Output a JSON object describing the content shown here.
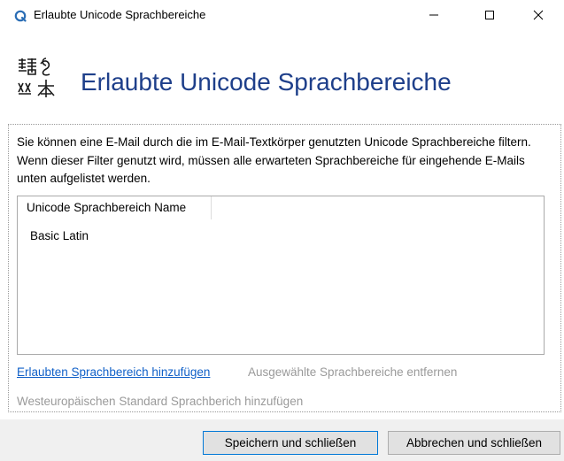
{
  "window": {
    "title": "Erlaubte Unicode Sprachbereiche",
    "controls": {
      "minimize": "—",
      "maximize": "☐",
      "close": "✕"
    }
  },
  "header": {
    "title": "Erlaubte Unicode Sprachbereiche",
    "icon": "language-characters-icon"
  },
  "description": "Sie können eine E-Mail durch die im E-Mail-Textkörper genutzten Unicode Sprachbereiche filtern. Wenn dieser Filter genutzt wird, müssen alle erwarteten Sprachbereiche für eingehende E-Mails unten aufgelistet werden.",
  "list": {
    "column_header": "Unicode Sprachbereich Name",
    "rows": [
      "Basic Latin"
    ]
  },
  "links": {
    "add": "Erlaubten Sprachbereich hinzufügen",
    "remove": "Ausgewählte Sprachbereiche entfernen",
    "add_western": "Westeuropäischen Standard Sprachberich hinzufügen"
  },
  "buttons": {
    "save": "Speichern und schließen",
    "cancel": "Abbrechen und schließen"
  },
  "colors": {
    "header_title": "#1e3f8a",
    "link_active": "#1060c8",
    "link_disabled": "#9a9a9a",
    "default_button_border": "#0078d7"
  }
}
